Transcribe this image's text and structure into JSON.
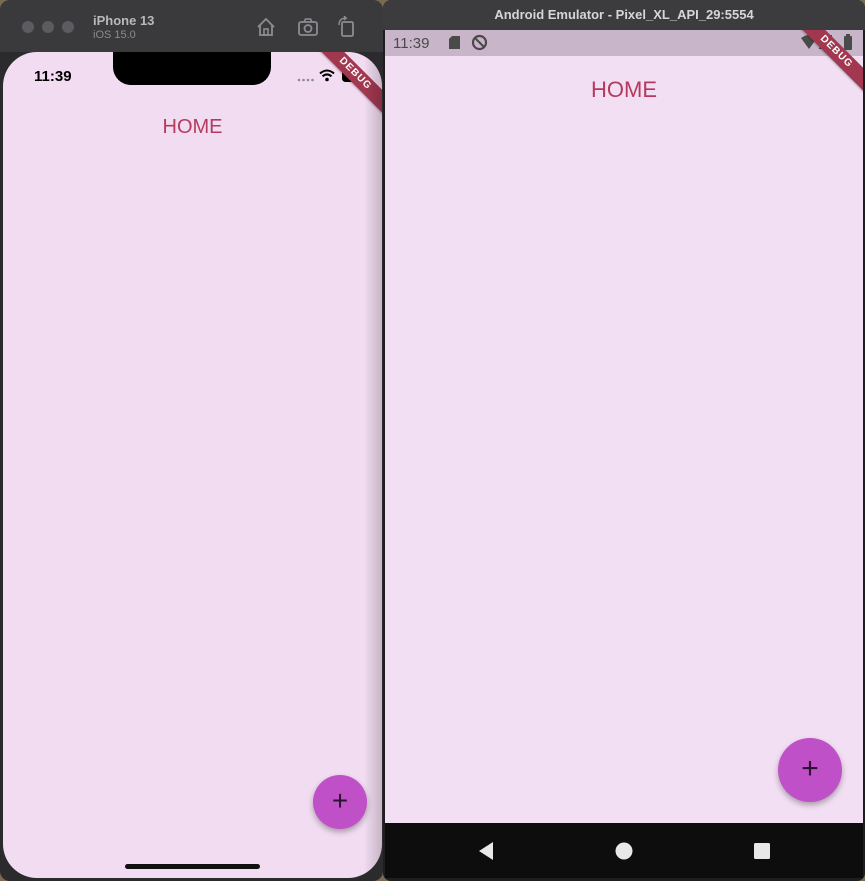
{
  "ios": {
    "device_name": "iPhone 13",
    "os_version": "iOS 15.0",
    "status_time": "11:39",
    "debug_label": "DEBUG",
    "app_title": "HOME",
    "fab_label": "+"
  },
  "android": {
    "window_title": "Android Emulator - Pixel_XL_API_29:5554",
    "status_time": "11:39",
    "debug_label": "DEBUG",
    "app_title": "HOME",
    "fab_label": "+"
  },
  "colors": {
    "screen_bg": "#f1dcf1",
    "title_color": "#b53b5e",
    "fab_bg": "#c050c8",
    "debug_banner": "#a23850"
  }
}
